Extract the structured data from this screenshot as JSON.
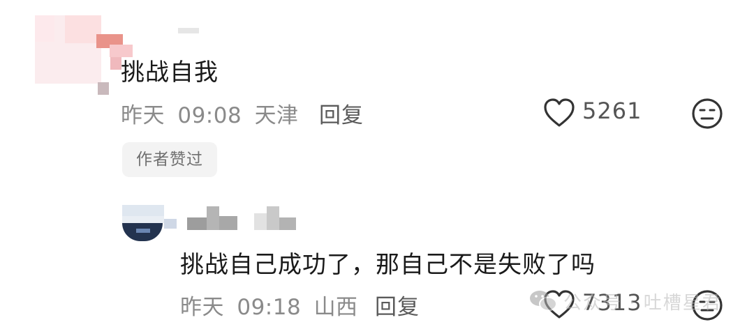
{
  "comment_1": {
    "text": "挑战自我",
    "date": "昨天",
    "time": "09:08",
    "location": "天津",
    "reply_label": "回复",
    "like_count": "5261",
    "badge": "作者赞过"
  },
  "comment_2": {
    "text": "挑战自己成功了，那自己不是失败了吗",
    "date": "昨天",
    "time": "09:18",
    "location": "山西",
    "reply_label": "回复",
    "like_count": "7313"
  },
  "watermark": {
    "text": "公众号 · 吐槽星君"
  },
  "icons": {
    "like": "heart-outline-icon",
    "reaction": "meh-face-icon",
    "watermark": "wechat-icon"
  },
  "colors": {
    "text": "#1a1a1a",
    "meta": "#8a8a8a",
    "badge_bg": "#f3f3f3"
  }
}
